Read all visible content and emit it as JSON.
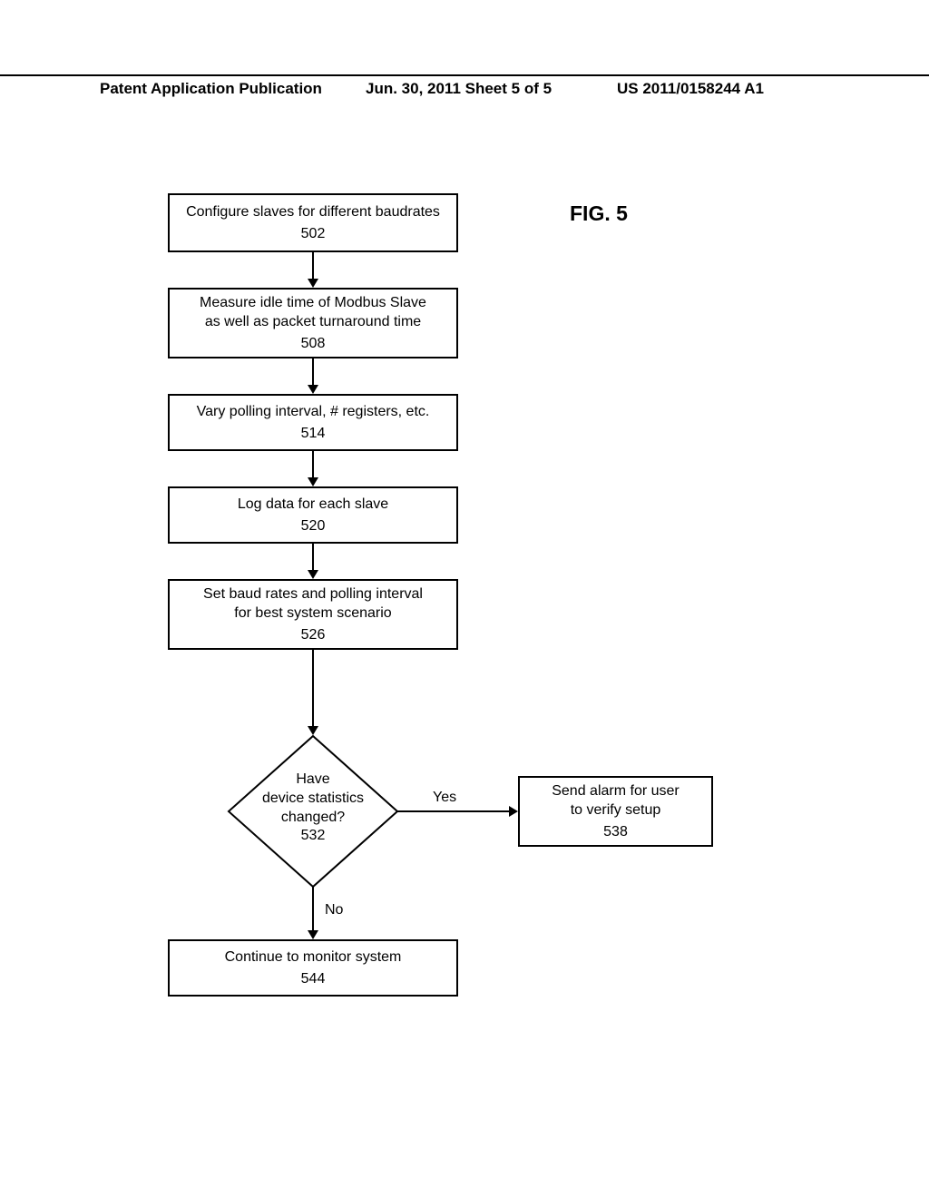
{
  "header": {
    "left": "Patent Application Publication",
    "center": "Jun. 30, 2011  Sheet 5 of 5",
    "right": "US 2011/0158244 A1"
  },
  "figure_label": "FIG. 5",
  "boxes": {
    "b502": {
      "text": "Configure slaves for different baudrates",
      "num": "502"
    },
    "b508": {
      "text_l1": "Measure idle time of Modbus Slave",
      "text_l2": "as well as packet turnaround time",
      "num": "508"
    },
    "b514": {
      "text": "Vary polling interval, # registers, etc.",
      "num": "514"
    },
    "b520": {
      "text": "Log data for each slave",
      "num": "520"
    },
    "b526": {
      "text_l1": "Set baud rates and polling interval",
      "text_l2": "for best system scenario",
      "num": "526"
    },
    "b538": {
      "text_l1": "Send alarm for user",
      "text_l2": "to verify setup",
      "num": "538"
    },
    "b544": {
      "text": "Continue to monitor system",
      "num": "544"
    }
  },
  "decision": {
    "l1": "Have",
    "l2": "device statistics",
    "l3": "changed?",
    "num": "532",
    "yes": "Yes",
    "no": "No"
  }
}
